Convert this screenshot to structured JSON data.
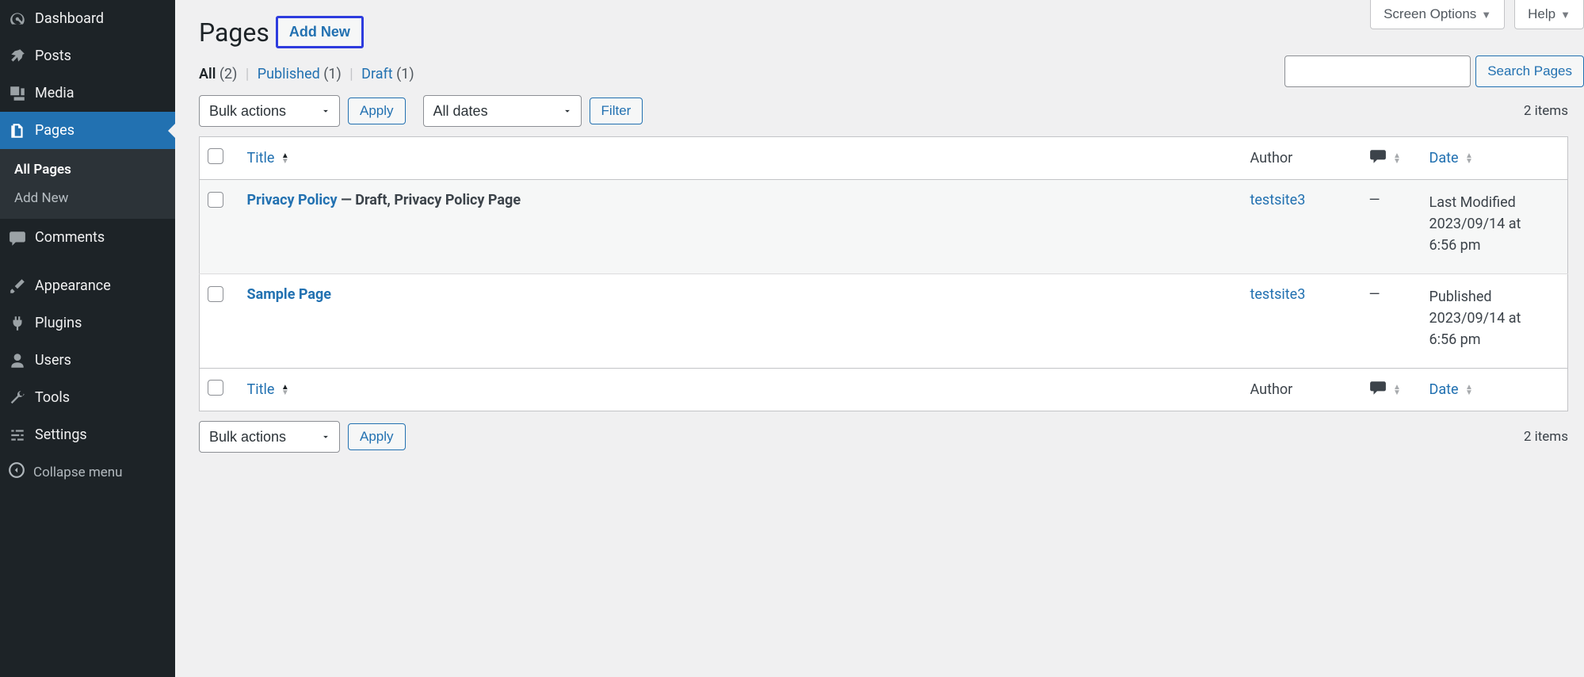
{
  "topTabs": {
    "screenOptions": "Screen Options",
    "help": "Help"
  },
  "sidebar": {
    "dashboard": "Dashboard",
    "posts": "Posts",
    "media": "Media",
    "pages": "Pages",
    "comments": "Comments",
    "appearance": "Appearance",
    "plugins": "Plugins",
    "users": "Users",
    "tools": "Tools",
    "settings": "Settings",
    "collapse": "Collapse menu",
    "submenu": {
      "allPages": "All Pages",
      "addNew": "Add New"
    }
  },
  "header": {
    "title": "Pages",
    "addNew": "Add New"
  },
  "filters": {
    "allLabel": "All",
    "allCount": "(2)",
    "publishedLabel": "Published",
    "publishedCount": "(1)",
    "draftLabel": "Draft",
    "draftCount": "(1)"
  },
  "search": {
    "button": "Search Pages"
  },
  "bulk": {
    "label": "Bulk actions",
    "apply": "Apply"
  },
  "dates": {
    "label": "All dates",
    "filter": "Filter"
  },
  "itemsCount": "2 items",
  "columns": {
    "title": "Title",
    "author": "Author",
    "date": "Date"
  },
  "rows": [
    {
      "title": "Privacy Policy",
      "state": " — Draft, Privacy Policy Page",
      "author": "testsite3",
      "comments": "—",
      "dateLine1": "Last Modified",
      "dateLine2": "2023/09/14 at",
      "dateLine3": "6:56 pm"
    },
    {
      "title": "Sample Page",
      "state": "",
      "author": "testsite3",
      "comments": "—",
      "dateLine1": "Published",
      "dateLine2": "2023/09/14 at",
      "dateLine3": "6:56 pm"
    }
  ]
}
